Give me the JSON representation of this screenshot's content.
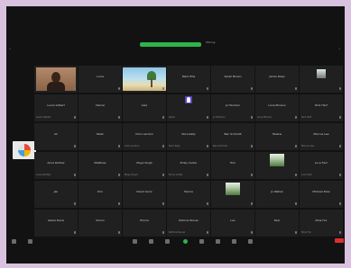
{
  "window": {
    "background": "#121212",
    "frame": "#d9c2e0"
  },
  "speaker": {
    "bar_color": "#2fb24c",
    "label": "Talking"
  },
  "participants": [
    {
      "type": "camera-person",
      "name": "",
      "sub": ""
    },
    {
      "type": "name",
      "name": "Lucia",
      "sub": ""
    },
    {
      "type": "camera-beach",
      "name": "",
      "sub": ""
    },
    {
      "type": "name",
      "name": "Mark Ellis",
      "sub": ""
    },
    {
      "type": "name",
      "name": "Sarah Brown",
      "sub": ""
    },
    {
      "type": "name",
      "name": "Jamie Rossi",
      "sub": ""
    },
    {
      "type": "thumb",
      "name": "",
      "sub": ""
    },
    {
      "type": "name",
      "name": "Laura Gilbert",
      "sub": "Laura Gilbert"
    },
    {
      "type": "name",
      "name": "Daniel",
      "sub": ""
    },
    {
      "type": "name",
      "name": "Alex",
      "sub": ""
    },
    {
      "type": "avatar",
      "name": "",
      "sub": "Karen"
    },
    {
      "type": "name",
      "name": "Jo Harrison",
      "sub": "Jo Harrison"
    },
    {
      "type": "name",
      "name": "Lena Moreno",
      "sub": "Lena Moreno"
    },
    {
      "type": "name",
      "name": "Rick Hart",
      "sub": "Rick Hart"
    },
    {
      "type": "name",
      "name": "Ali",
      "sub": ""
    },
    {
      "type": "name",
      "name": "Peter",
      "sub": ""
    },
    {
      "type": "name",
      "name": "Chris Landon",
      "sub": "Chris Landon"
    },
    {
      "type": "name",
      "name": "Nora Kelly",
      "sub": "Nora Kelly"
    },
    {
      "type": "name",
      "name": "Ben Schmidt",
      "sub": "Ben Schmidt"
    },
    {
      "type": "name",
      "name": "Helena",
      "sub": ""
    },
    {
      "type": "name",
      "name": "Marcus Lee",
      "sub": "Marcus Lee"
    },
    {
      "type": "name",
      "name": "Anna Richter",
      "sub": "Anna Richter"
    },
    {
      "type": "name",
      "name": "Matthias",
      "sub": ""
    },
    {
      "type": "name",
      "name": "Maya Singh",
      "sub": "Maya Singh"
    },
    {
      "type": "name",
      "name": "Emily Carter",
      "sub": "Emily Carter"
    },
    {
      "type": "name",
      "name": "Tom",
      "sub": ""
    },
    {
      "type": "thumb-green",
      "name": "",
      "sub": ""
    },
    {
      "type": "name",
      "name": "Luca Ferri",
      "sub": "Luca Ferri"
    },
    {
      "type": "name",
      "name": "Jan",
      "sub": ""
    },
    {
      "type": "name",
      "name": "Kim",
      "sub": ""
    },
    {
      "type": "name",
      "name": "David Gonz",
      "sub": ""
    },
    {
      "type": "name",
      "name": "Hanna",
      "sub": ""
    },
    {
      "type": "thumb-green",
      "name": "",
      "sub": ""
    },
    {
      "type": "name",
      "name": "Jo Walker",
      "sub": ""
    },
    {
      "type": "name",
      "name": "Michael Ross",
      "sub": ""
    },
    {
      "type": "name",
      "name": "Isabel Davis",
      "sub": ""
    },
    {
      "type": "name",
      "name": "Simon",
      "sub": ""
    },
    {
      "type": "name",
      "name": "Emma",
      "sub": ""
    },
    {
      "type": "name",
      "name": "Patricia Nunez",
      "sub": "Patricia Nunez"
    },
    {
      "type": "name",
      "name": "Leo",
      "sub": ""
    },
    {
      "type": "name",
      "name": "Ravi",
      "sub": ""
    },
    {
      "type": "name",
      "name": "Nina Fox",
      "sub": "Nina Fox"
    }
  ],
  "toolbar": {
    "left": [
      "Mute",
      "Video"
    ],
    "center": [
      "Security",
      "Participants",
      "Chat",
      "Share",
      "Record",
      "Reactions",
      "Apps",
      "More"
    ],
    "end_label": "End"
  }
}
